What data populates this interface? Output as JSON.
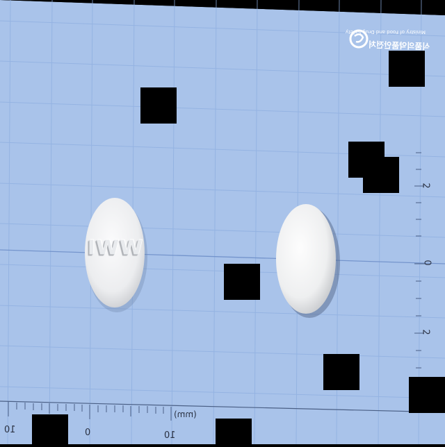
{
  "photo": {
    "background_color": "#a9c3ea",
    "grid_color": "#7f9fd3",
    "border_color": "#000000"
  },
  "watermark": {
    "logo_icon": "ministry-swirl-icon",
    "line1": "식품의약품안전처",
    "line2": "Ministry of Food and Drug Safety"
  },
  "pills": [
    {
      "imprint": "WWI",
      "shape": "round",
      "color": "#f1f2f3"
    },
    {
      "imprint": "",
      "shape": "round",
      "color": "#f3f4f5"
    }
  ],
  "scale_bottom": {
    "labels": [
      "10",
      "0",
      "10"
    ],
    "unit": "(mm)"
  },
  "scale_right": {
    "labels": [
      "2",
      "0",
      "2"
    ]
  }
}
